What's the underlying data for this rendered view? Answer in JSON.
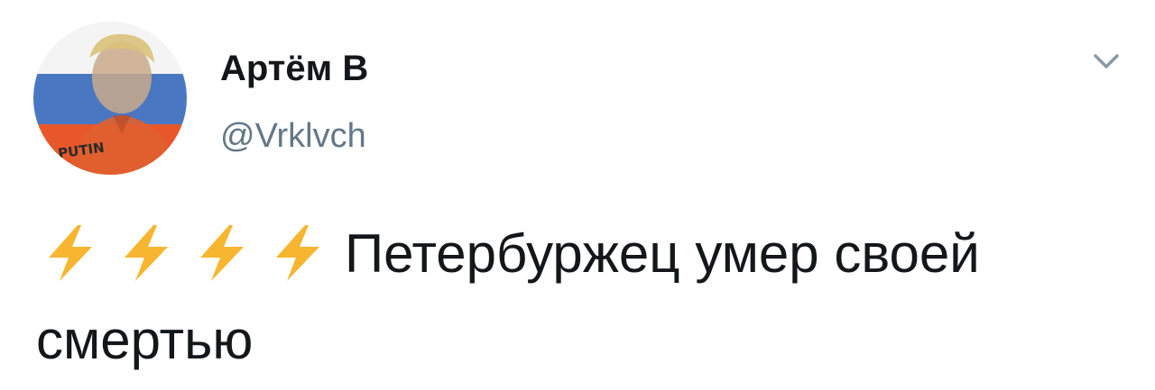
{
  "tweet": {
    "author": {
      "display_name": "Артём В",
      "handle": "@Vrklvch",
      "avatar_text": "PUTIN"
    },
    "menu_icon": "chevron-down-icon",
    "emoji": [
      "high-voltage-icon",
      "high-voltage-icon",
      "high-voltage-icon",
      "high-voltage-icon"
    ],
    "text": "Петербуржец умер своей смертью"
  },
  "colors": {
    "text_primary": "#14171a",
    "text_secondary": "#657786",
    "bolt_yellow": "#f7b530",
    "flag_white": "#ffffff",
    "flag_blue": "#3a6fbf",
    "flag_red": "#e8542a"
  }
}
